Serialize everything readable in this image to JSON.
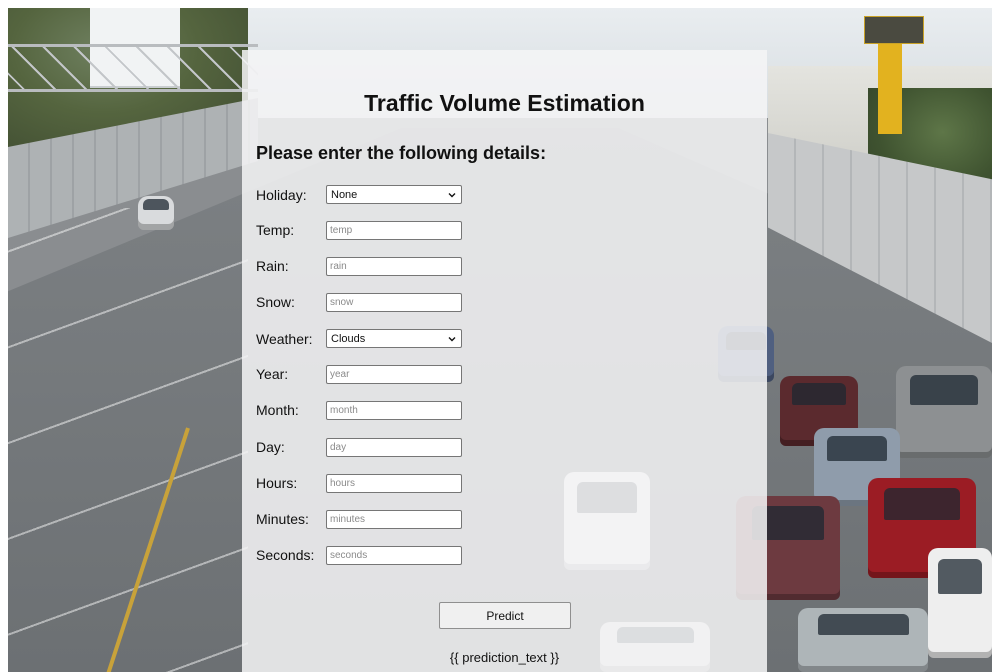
{
  "header": {
    "title": "Traffic Volume Estimation",
    "subtitle": "Please enter the following details:"
  },
  "form": {
    "holiday": {
      "label": "Holiday:",
      "value": "None"
    },
    "temp": {
      "label": "Temp:",
      "placeholder": "temp"
    },
    "rain": {
      "label": "Rain:",
      "placeholder": "rain"
    },
    "snow": {
      "label": "Snow:",
      "placeholder": "snow"
    },
    "weather": {
      "label": "Weather:",
      "value": "Clouds"
    },
    "year": {
      "label": "Year:",
      "placeholder": "year"
    },
    "month": {
      "label": "Month:",
      "placeholder": "month"
    },
    "day": {
      "label": "Day:",
      "placeholder": "day"
    },
    "hours": {
      "label": "Hours:",
      "placeholder": "hours"
    },
    "minutes": {
      "label": "Minutes:",
      "placeholder": "minutes"
    },
    "seconds": {
      "label": "Seconds:",
      "placeholder": "seconds"
    }
  },
  "actions": {
    "predict_label": "Predict"
  },
  "result": {
    "prediction_text": "{{ prediction_text }}"
  },
  "icons": {
    "select_chevron": "chevron-down-icon"
  },
  "colors": {
    "panel_background": "#f4f5f6",
    "text": "#111111",
    "input_border": "#767676"
  }
}
